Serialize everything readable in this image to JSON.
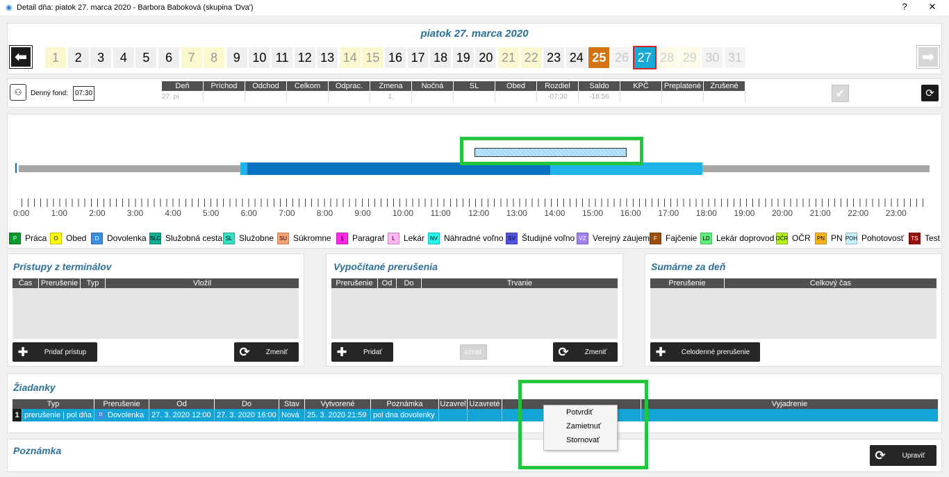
{
  "window": {
    "title": "Detail dňa: piatok 27. marca 2020 -  Barbora Baboková  (skupina 'Dva')",
    "help": "?",
    "close": "✕"
  },
  "header": {
    "date_title": "piatok 27. marca 2020",
    "days": [
      {
        "n": "1",
        "s": "wk"
      },
      {
        "n": "2",
        "s": "ok"
      },
      {
        "n": "3",
        "s": "ok"
      },
      {
        "n": "4",
        "s": "ok"
      },
      {
        "n": "5",
        "s": "ok"
      },
      {
        "n": "6",
        "s": "ok"
      },
      {
        "n": "7",
        "s": "wk"
      },
      {
        "n": "8",
        "s": "wk"
      },
      {
        "n": "9",
        "s": "ok"
      },
      {
        "n": "10",
        "s": "ok"
      },
      {
        "n": "11",
        "s": "ok"
      },
      {
        "n": "12",
        "s": "ok"
      },
      {
        "n": "13",
        "s": "ok"
      },
      {
        "n": "14",
        "s": "wk"
      },
      {
        "n": "15",
        "s": "wk"
      },
      {
        "n": "16",
        "s": "ok"
      },
      {
        "n": "17",
        "s": "ok"
      },
      {
        "n": "18",
        "s": "ok"
      },
      {
        "n": "19",
        "s": "ok"
      },
      {
        "n": "20",
        "s": "ok"
      },
      {
        "n": "21",
        "s": "wk"
      },
      {
        "n": "22",
        "s": "wk"
      },
      {
        "n": "23",
        "s": "ok"
      },
      {
        "n": "24",
        "s": "ok"
      },
      {
        "n": "25",
        "s": "hl"
      },
      {
        "n": "26",
        "s": "fut"
      },
      {
        "n": "27",
        "s": "sel"
      },
      {
        "n": "28",
        "s": "futwk"
      },
      {
        "n": "29",
        "s": "futwk"
      },
      {
        "n": "30",
        "s": "fut"
      },
      {
        "n": "31",
        "s": "fut"
      }
    ]
  },
  "fund": {
    "label": "Denný fond:",
    "value": "07:30"
  },
  "summary": {
    "columns": [
      "Deň",
      "Príchod",
      "Odchod",
      "Celkom",
      "Odprac.",
      "Zmena",
      "Nočná",
      "SL",
      "Obed",
      "Rozdiel",
      "Saldo",
      "KPČ",
      "Preplatené",
      "Zrušené"
    ],
    "row": [
      "27. pi",
      "",
      "",
      "",
      "",
      "1.",
      "",
      "",
      "",
      "-07:30",
      "-18:56",
      "",
      "",
      ""
    ]
  },
  "timeline": {
    "hours": [
      "0:00",
      "1:00",
      "2:00",
      "3:00",
      "4:00",
      "5:00",
      "6:00",
      "7:00",
      "8:00",
      "9:00",
      "10:00",
      "11:00",
      "12:00",
      "13:00",
      "14:00",
      "15:00",
      "16:00",
      "17:00",
      "18:00",
      "19:00",
      "20:00",
      "21:00",
      "22:00",
      "23:00"
    ]
  },
  "legend": [
    {
      "code": "P",
      "label": "Práca",
      "bg": "#0a9a2a",
      "fg": "#ffffff"
    },
    {
      "code": "O",
      "label": "Obed",
      "bg": "#ffff00",
      "fg": "#000000"
    },
    {
      "code": "D",
      "label": "Dovolenka",
      "bg": "#3b8fe0",
      "fg": "#ffffff"
    },
    {
      "code": "SLC",
      "label": "Služobná cesta",
      "bg": "#0fb096",
      "fg": "#000000"
    },
    {
      "code": "SL",
      "label": "Služobne",
      "bg": "#34e0c2",
      "fg": "#000000"
    },
    {
      "code": "SU",
      "label": "Súkromne",
      "bg": "#ffa272",
      "fg": "#000000"
    },
    {
      "code": "§",
      "label": "Paragraf",
      "bg": "#ff2ae8",
      "fg": "#000000"
    },
    {
      "code": "L",
      "label": "Lekár",
      "bg": "#ffb7f2",
      "fg": "#000000"
    },
    {
      "code": "NV",
      "label": "Náhradné voľno",
      "bg": "#23f7f0",
      "fg": "#000000"
    },
    {
      "code": "SV",
      "label": "Študijné voľno",
      "bg": "#5252e0",
      "fg": "#000000"
    },
    {
      "code": "VZ",
      "label": "Verejný záujem",
      "bg": "#a27ef0",
      "fg": "#ffffff"
    },
    {
      "code": "F",
      "label": "Fajčenie",
      "bg": "#9a4f0e",
      "fg": "#ffffff"
    },
    {
      "code": "LD",
      "label": "Lekár doprovod",
      "bg": "#5cf07a",
      "fg": "#000000"
    },
    {
      "code": "OČR",
      "label": "OČR",
      "bg": "#b4f21a",
      "fg": "#000000"
    },
    {
      "code": "PN",
      "label": "PN",
      "bg": "#ffb31a",
      "fg": "#000000"
    },
    {
      "code": "POH",
      "label": "Pohotovosť",
      "bg": "#c7f2ff",
      "fg": "#000000"
    },
    {
      "code": "TS",
      "label": "Test",
      "bg": "#9c0f0f",
      "fg": "#ffffff"
    }
  ],
  "pristupy": {
    "title": "Prístupy z terminálov",
    "columns": [
      "Čas",
      "Prerušenie",
      "Typ",
      "Vložil"
    ],
    "add_label": "Pridať prístup",
    "change_label": "Zmeniť"
  },
  "prerusenia": {
    "title": "Vypočítané prerušenia",
    "columns": [
      "Prerušenie",
      "Od",
      "Do",
      "Trvanie"
    ],
    "add_label": "Pridať",
    "uznat_label": "uznať",
    "change_label": "Zmeniť"
  },
  "sumarne": {
    "title": "Sumárne za deň",
    "columns": [
      "Prerušenie",
      "Celkový čas"
    ],
    "add_label": "Celodenné prerušenie"
  },
  "ziadanky": {
    "title": "Žiadanky",
    "columns": [
      "Typ",
      "Prerušenie",
      "Od",
      "Do",
      "Stav",
      "Vytvorené",
      "Poznámka",
      "Uzavrel",
      "Uzavreté",
      "",
      "Vyjadrenie"
    ],
    "row": {
      "num": "1",
      "typ": "prerušenie | pol dňa",
      "prerusenie_code": "D",
      "prerusenie": "Dovolenka",
      "od": "27. 3. 2020 12:00",
      "do": "27. 3. 2020 16:00",
      "stav": "Nová",
      "vytvorene": "25. 3. 2020  21:59",
      "poznamka": "pol dna dovolenky"
    },
    "menu": [
      "Potvrdiť",
      "Zamietnuť",
      "Stornovať"
    ]
  },
  "poznamka": {
    "title": "Poznámka",
    "edit_label": "Upraviť"
  }
}
